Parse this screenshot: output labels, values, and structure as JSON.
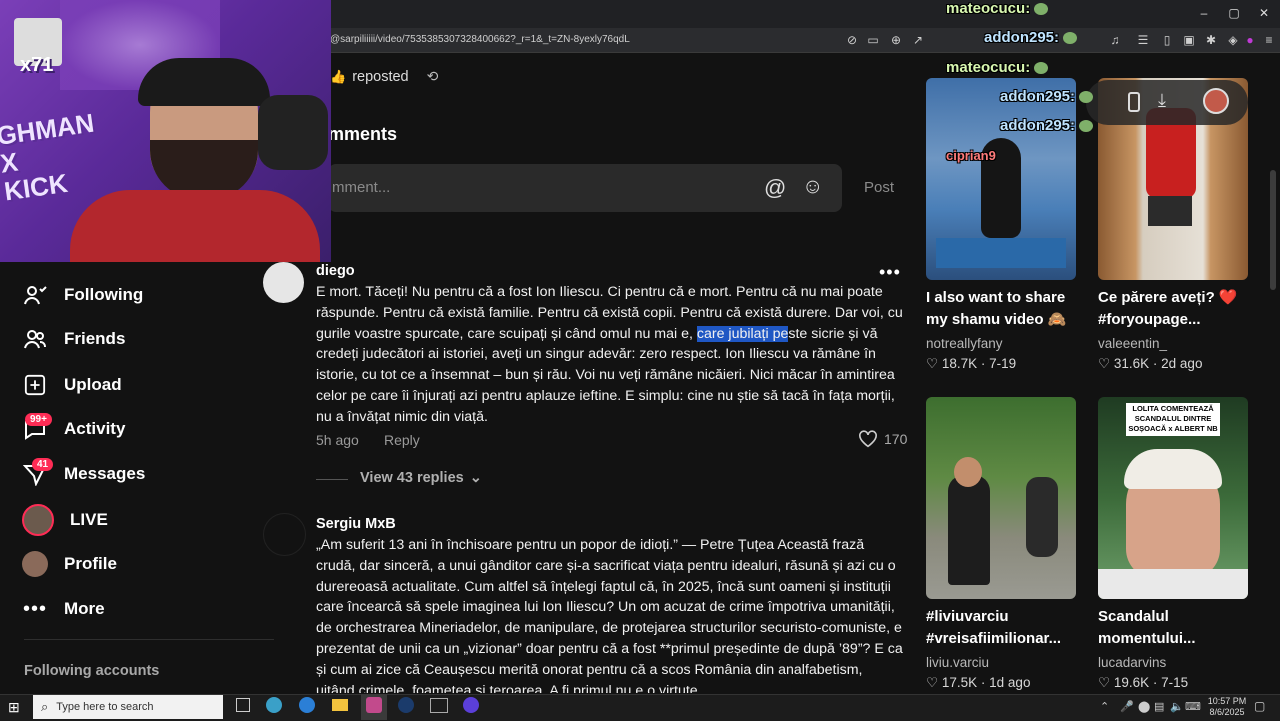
{
  "browser": {
    "url": "@sarpiliiiii/video/7535385307328400662?_r=1&_t=ZN-8yexly76qdL",
    "window_controls": [
      "–",
      "▢",
      "✕"
    ]
  },
  "chat": {
    "lines": [
      {
        "user": "mateocucu:"
      },
      {
        "user": "addon295:"
      },
      {
        "user": "mateocucu:"
      },
      {
        "user": "addon295:"
      },
      {
        "user": "addon295:"
      },
      {
        "user": "ciprian9"
      }
    ]
  },
  "webcam": {
    "badge": "x71",
    "overlay_text": "GHMAN\nX\nKICK"
  },
  "video_header": {
    "reposted": "reposted"
  },
  "comments_section": {
    "heading": "mments",
    "input_placeholder": "mment...",
    "post_label": "Post"
  },
  "sidebar": {
    "items": [
      {
        "label": "Following",
        "icon": "following-icon"
      },
      {
        "label": "Friends",
        "icon": "friends-icon"
      },
      {
        "label": "Upload",
        "icon": "upload-icon"
      },
      {
        "label": "Activity",
        "icon": "activity-icon",
        "badge": "99+"
      },
      {
        "label": "Messages",
        "icon": "messages-icon",
        "badge": "41"
      },
      {
        "label": "LIVE",
        "icon": "live-icon"
      },
      {
        "label": "Profile",
        "icon": "profile-icon"
      },
      {
        "label": "More",
        "icon": "more-icon"
      }
    ],
    "following_accounts": "Following accounts"
  },
  "comments": [
    {
      "user": "diego",
      "text_before": "E mort. Tăceți! Nu pentru că a fost Ion Iliescu. Ci pentru că e mort. Pentru că nu mai poate răspunde. Pentru că există familie. Pentru că există copii. Pentru că există durere. Dar voi, cu gurile voastre spurcate, care scuipați și când omul nu mai e, ",
      "text_highlight": "care jubilați pe",
      "text_after": "ste sicrie și vă credeți judecători ai istoriei, aveți un singur adevăr: zero respect. Ion Iliescu va rămâne în istorie, cu tot ce a însemnat – bun și rău. Voi nu veți rămâne nicăieri. Nici măcar în amintirea celor pe care îi înjurați azi pentru aplauze ieftine. E simplu: cine nu știe să tacă în fața morții, nu a învățat nimic din viață.",
      "time": "5h ago",
      "reply": "Reply",
      "likes": "170",
      "view_replies": "View 43 replies"
    },
    {
      "user": "Sergiu MxB",
      "text": "„Am suferit 13 ani în închisoare pentru un popor de idioți.” — Petre Țuțea Această frază crudă, dar sinceră, a unui gânditor care și-a sacrificat viața pentru idealuri, răsună și azi cu o durereoasă actualitate. Cum altfel să înțelegi faptul că, în 2025, încă sunt oameni și instituții care încearcă să spele imaginea lui Ion Iliescu? Un om acuzat de crime împotriva umanității, de orchestrarea Mineriadelor, de manipulare, de protejarea structurilor securisto-comuniste, e prezentat de unii ca un „vizionar” doar pentru că a fost **primul președinte de după ’89”? E ca și cum ai zice că Ceaușescu merită onorat pentru că a scos România din analfabetism, uitând crimele, foametea și teroarea. A fi primul nu e o virtute"
    }
  ],
  "videos": [
    {
      "title": "I also want to share my shamu video 🙈",
      "user": "notreallyfany",
      "likes": "18.7K",
      "date": "7-19"
    },
    {
      "title": "Ce părere aveți? ❤️ #foryoupage...",
      "user": "valeeentin_",
      "likes": "31.6K",
      "date": "2d ago"
    },
    {
      "title": "#liviuvarciu #vreisafiimilionar...",
      "user": "liviu.varciu",
      "likes": "17.5K",
      "date": "1d ago"
    },
    {
      "title": "Scandalul momentului...",
      "user": "lucadarvins",
      "likes": "19.6K",
      "date": "7-15",
      "thumb_caption": "LOLITA COMENTEAZĂ SCANDALUL DINTRE SOȘOACĂ x ALBERT NB"
    }
  ],
  "taskbar": {
    "search_placeholder": "Type here to search",
    "time": "10:57 PM",
    "date": "8/6/2025"
  }
}
